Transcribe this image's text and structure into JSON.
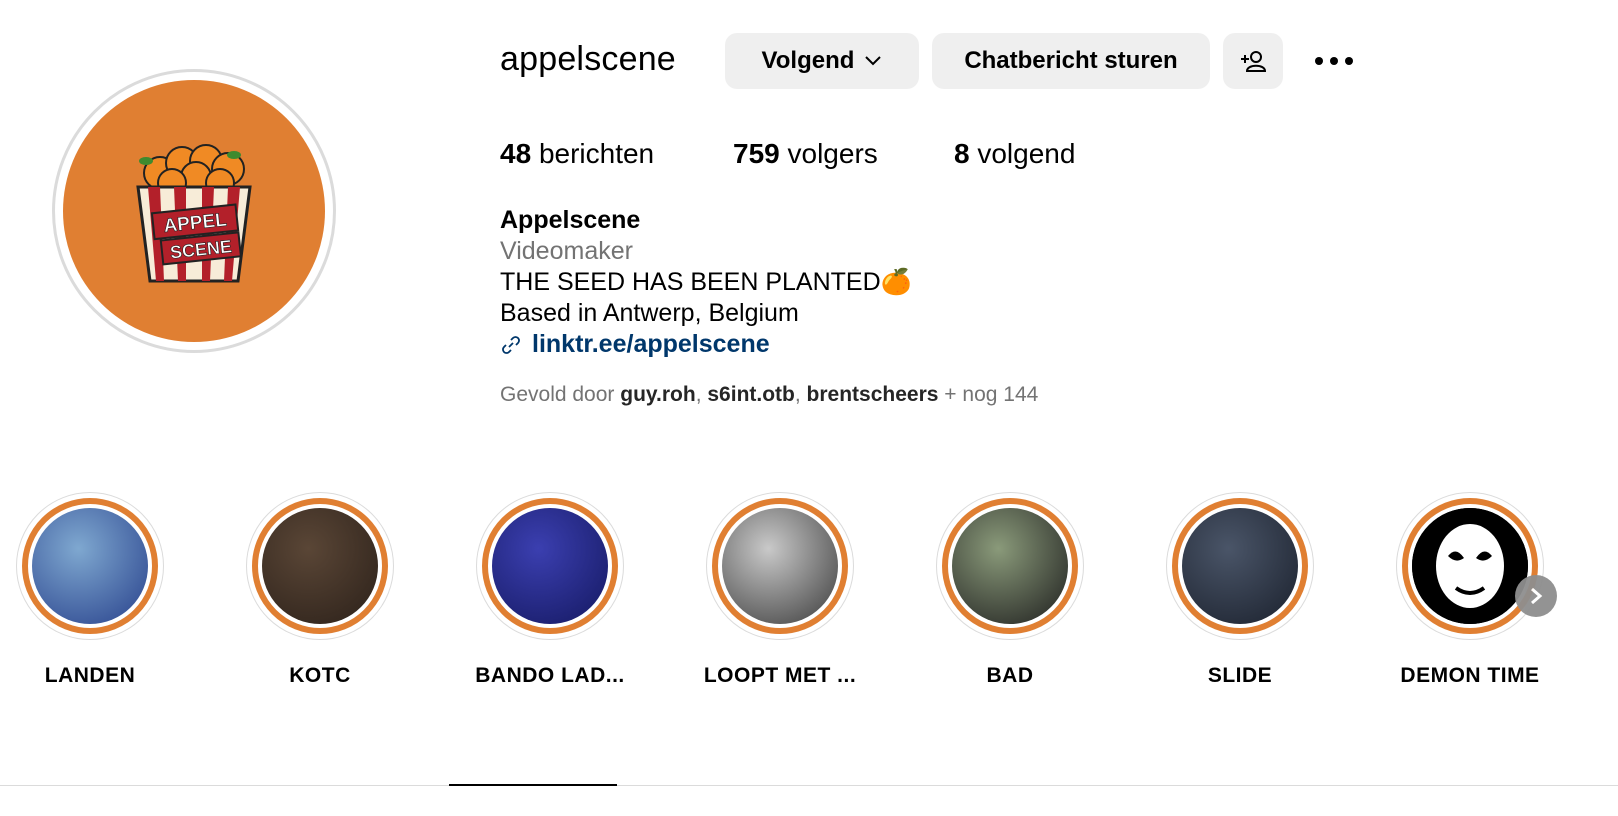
{
  "profile": {
    "username": "appelscene",
    "avatar_text_top": "APPEL",
    "avatar_text_bottom": "SCENE",
    "avatar_color": "#e07f32"
  },
  "actions": {
    "following_label": "Volgend",
    "message_label": "Chatbericht sturen",
    "suggest_icon": "add-person-icon",
    "more_icon": "more-options-icon"
  },
  "stats": {
    "posts_count": "48",
    "posts_label": "berichten",
    "followers_count": "759",
    "followers_label": "volgers",
    "following_count": "8",
    "following_label": "volgend"
  },
  "bio": {
    "name": "Appelscene",
    "category": "Videomaker",
    "line1": "THE SEED HAS BEEN PLANTED🍊",
    "line2": "Based in Antwerp, Belgium",
    "link": "linktr.ee/appelscene"
  },
  "followed_by": {
    "prefix": "Gevold door",
    "users": [
      "guy.roh",
      "s6int.otb",
      "brentscheers"
    ],
    "suffix": "+ nog 144"
  },
  "highlights": [
    {
      "label": "LANDEN",
      "colors": [
        "#7fa8d0",
        "#27408b"
      ]
    },
    {
      "label": "KOTC",
      "colors": [
        "#5a4636",
        "#2b2019"
      ]
    },
    {
      "label": "BANDO LAD...",
      "colors": [
        "#3b3fb0",
        "#141860"
      ]
    },
    {
      "label": "LOOPT MET ...",
      "colors": [
        "#c9c9c9",
        "#3a3a3a"
      ]
    },
    {
      "label": "BAD",
      "colors": [
        "#8a9a7a",
        "#1d1d1d"
      ]
    },
    {
      "label": "SLIDE",
      "colors": [
        "#4a5568",
        "#1a202c"
      ]
    },
    {
      "label": "DEMON TIME",
      "colors": [
        "#000000",
        "#000000"
      ]
    }
  ],
  "accent_ring_color": "#e07f32"
}
